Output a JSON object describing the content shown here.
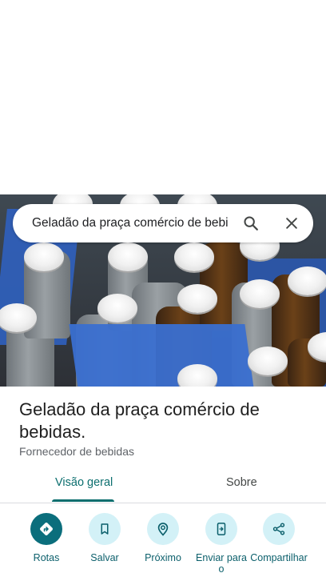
{
  "search": {
    "query": "Geladão da praça comércio de bebi"
  },
  "place": {
    "name": "Geladão da praça comércio de bebidas.",
    "category": "Fornecedor de bebidas"
  },
  "tabs": [
    {
      "label": "Visão geral",
      "active": true
    },
    {
      "label": "Sobre",
      "active": false
    }
  ],
  "actions": [
    {
      "label": "Rotas",
      "icon": "directions-icon"
    },
    {
      "label": "Salvar",
      "icon": "bookmark-icon"
    },
    {
      "label": "Próximo",
      "icon": "nearby-icon"
    },
    {
      "label": "Enviar para o",
      "icon": "send-to-phone-icon"
    },
    {
      "label": "Compartilhar",
      "icon": "share-icon"
    }
  ],
  "colors": {
    "accent": "#0b6e6e",
    "action_bg": "#d3f1f7",
    "primary_action_bg": "#0b6e7c"
  }
}
